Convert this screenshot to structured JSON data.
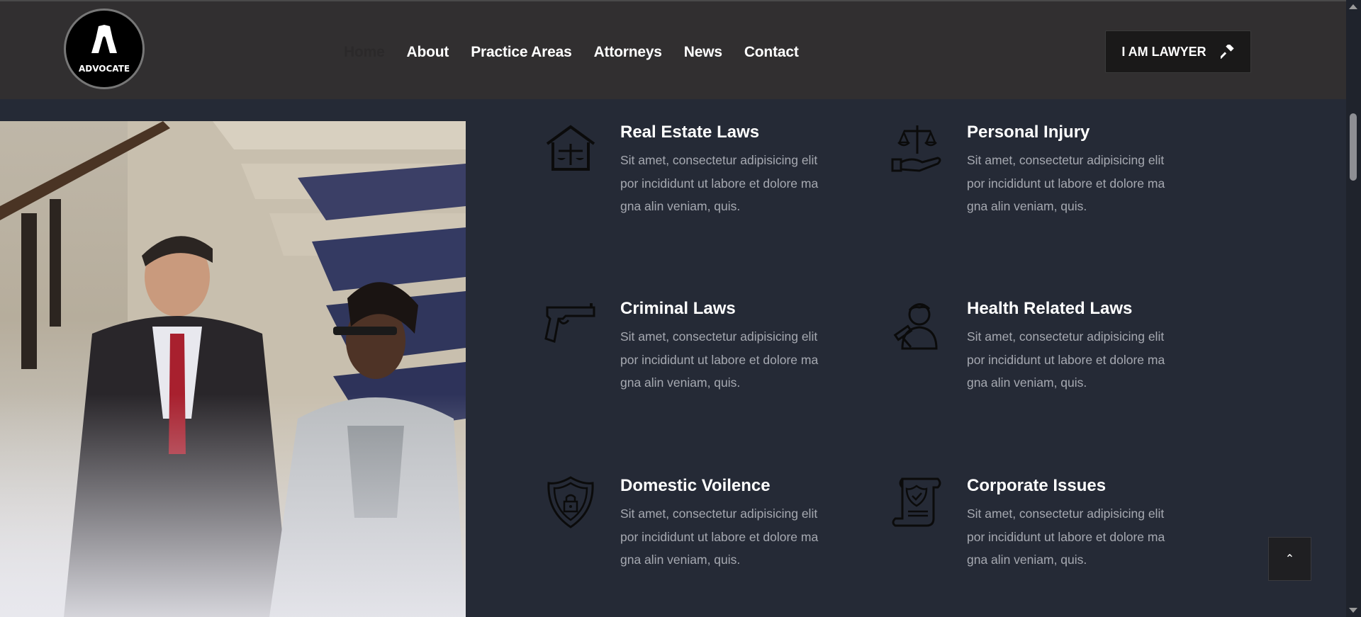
{
  "brand": {
    "logo_text": "ADVOCATE",
    "icon": "advocate-bands-logo"
  },
  "nav": {
    "items": [
      {
        "label": "Home",
        "active": true
      },
      {
        "label": "About"
      },
      {
        "label": "Practice Areas"
      },
      {
        "label": "Attorneys"
      },
      {
        "label": "News"
      },
      {
        "label": "Contact"
      }
    ]
  },
  "cta": {
    "label": "I AM LAWYER",
    "icon": "gavel-icon"
  },
  "services": [
    {
      "title": "Real Estate Laws",
      "desc": "Sit amet, consectetur adipisicing elit por incididunt ut labore et dolore ma gna alin veniam, quis.",
      "icon": "house-scales-icon"
    },
    {
      "title": "Personal Injury",
      "desc": "Sit amet, consectetur adipisicing elit por incididunt ut labore et dolore ma gna alin veniam, quis.",
      "icon": "hand-scales-icon"
    },
    {
      "title": "Criminal Laws",
      "desc": "Sit amet, consectetur adipisicing elit por incididunt ut labore et dolore ma gna alin veniam, quis.",
      "icon": "pistol-icon"
    },
    {
      "title": "Health Related Laws",
      "desc": "Sit amet, consectetur adipisicing elit por incididunt ut labore et dolore ma gna alin veniam, quis.",
      "icon": "judge-gavel-icon"
    },
    {
      "title": "Domestic Voilence",
      "desc": "Sit amet, consectetur adipisicing elit por incididunt ut labore et dolore ma gna alin veniam, quis.",
      "icon": "shield-lock-icon"
    },
    {
      "title": "Corporate Issues",
      "desc": "Sit amet, consectetur adipisicing elit por incididunt ut labore et dolore ma gna alin veniam, quis.",
      "icon": "document-shield-icon"
    }
  ],
  "back_to_top": {
    "icon": "chevron-up-icon",
    "symbol": "⌃"
  },
  "colors": {
    "header_bg": "#312f30",
    "body_bg": "#252a36",
    "cta_bg": "#1a1919"
  }
}
